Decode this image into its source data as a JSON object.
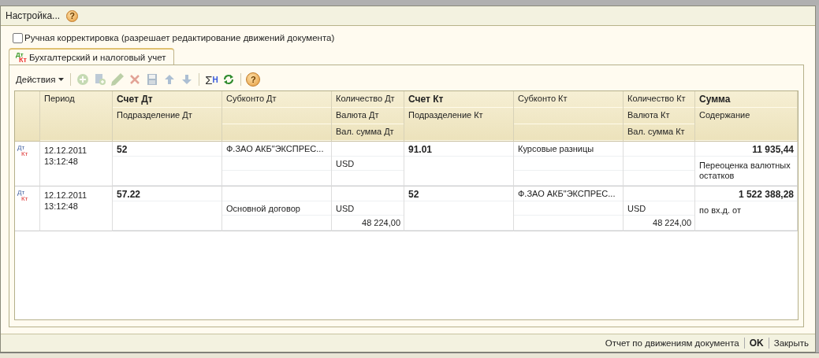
{
  "menu": {
    "items": [
      {
        "label": "Настройка..."
      }
    ],
    "help": "?"
  },
  "manual_edit": {
    "label": "Ручная корректировка (разрешает редактирование движений документа)",
    "checked": false
  },
  "tabs": [
    {
      "label": "Бухгалтерский и налоговый учет",
      "icon_text": {
        "debit": "Дт",
        "credit": "Кт"
      },
      "selected": true
    }
  ],
  "toolbar": {
    "actions_label": "Действия",
    "buttons": [
      {
        "kind": "add",
        "disabled": true
      },
      {
        "kind": "copy",
        "disabled": true
      },
      {
        "kind": "edit",
        "disabled": true
      },
      {
        "kind": "delete",
        "disabled": true
      },
      {
        "kind": "save",
        "disabled": true
      },
      {
        "kind": "up",
        "disabled": true
      },
      {
        "kind": "down",
        "disabled": true
      },
      {
        "kind": "sum",
        "text": "Σ",
        "subscript": "Н",
        "disabled": false
      },
      {
        "kind": "refresh",
        "disabled": false
      },
      {
        "kind": "help",
        "text": "?",
        "disabled": false
      }
    ]
  },
  "table": {
    "columns": [
      {
        "kind": "period",
        "line1": "Период"
      },
      {
        "kind": "account",
        "line1": "Счет Дт",
        "line2": "Подразделение Дт"
      },
      {
        "kind": "subconto",
        "line1": "Субконто Дт"
      },
      {
        "kind": "quantity",
        "line1": "Количество Дт",
        "line2": "Валюта Дт",
        "line3": "Вал. сумма Дт"
      },
      {
        "kind": "account",
        "line1": "Счет Кт",
        "line2": "Подразделение Кт"
      },
      {
        "kind": "subconto",
        "line1": "Субконто Кт"
      },
      {
        "kind": "quantity",
        "line1": "Количество Кт",
        "line2": "Валюта Кт",
        "line3": "Вал. сумма Кт"
      },
      {
        "kind": "sum",
        "line1": "Сумма",
        "line2": "Содержание"
      }
    ],
    "rows": [
      {
        "entry_type": {
          "debit": "Дт",
          "credit": "Кт"
        },
        "selected": false,
        "cells": [
          {
            "line1": "12.12.2011",
            "line2": "13:12:48"
          },
          {
            "line1": "52"
          },
          {
            "line1": "Ф.ЗАО АКБ\"ЭКСПРЕС..."
          },
          {
            "line2": "USD"
          },
          {
            "line1": "91.01"
          },
          {
            "line1": "Курсовые разницы"
          },
          {},
          {
            "line1": "11 935,44",
            "line2": "Переоценка валютных остатков"
          }
        ]
      },
      {
        "entry_type": {
          "debit": "Дт",
          "credit": "Кт"
        },
        "selected": false,
        "cells": [
          {
            "line1": "12.12.2011",
            "line2": "13:12:48"
          },
          {
            "line1": "57.22"
          },
          {
            "line2": "Основной договор"
          },
          {
            "line2": "USD",
            "line3": "48 224,00"
          },
          {
            "line1": "52"
          },
          {
            "line1": "Ф.ЗАО АКБ\"ЭКСПРЕС..."
          },
          {
            "line2": "USD",
            "line3": "48 224,00"
          },
          {
            "line1": "1 522 388,28",
            "line2": "по вх.д. от"
          }
        ]
      }
    ]
  },
  "footer": {
    "buttons": [
      {
        "label": "Отчет по движениям документа",
        "default": false
      },
      {
        "label": "OK",
        "default": true
      },
      {
        "label": "Закрыть",
        "default": false
      }
    ]
  }
}
